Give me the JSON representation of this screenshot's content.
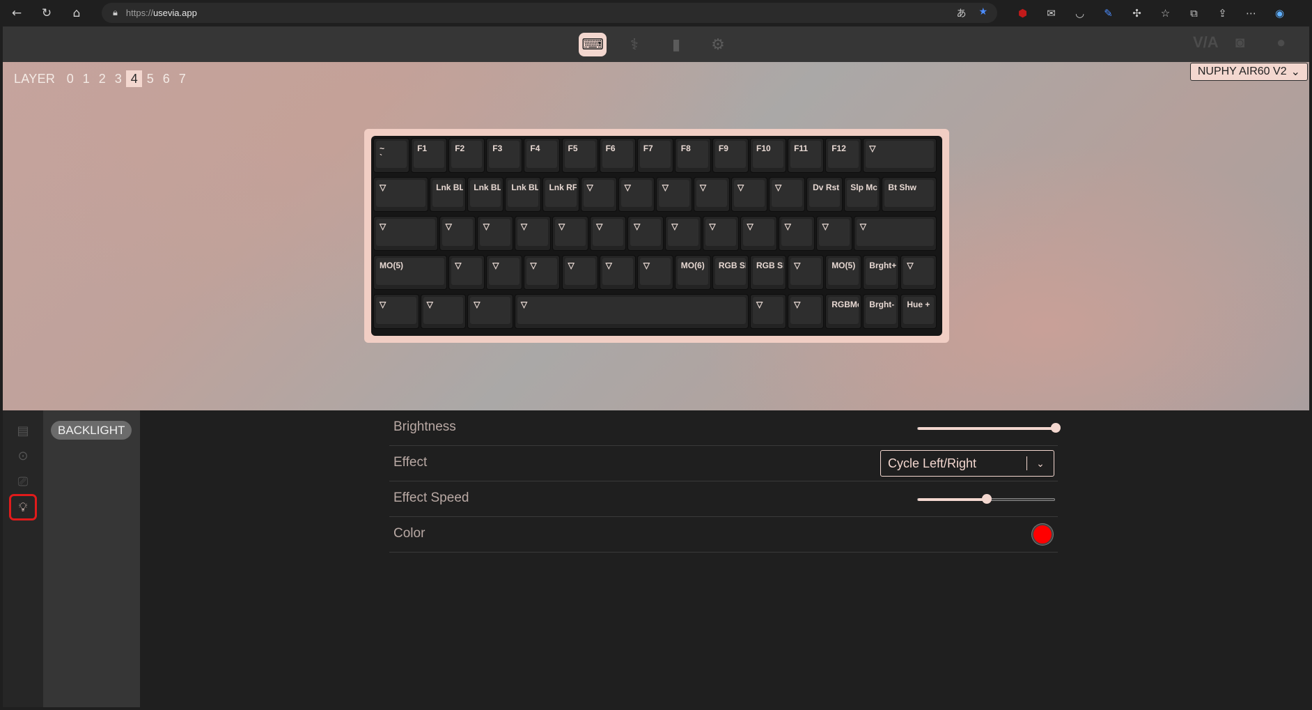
{
  "browser": {
    "url_scheme": "https://",
    "url_host": "usevia.app"
  },
  "layers": {
    "label": "LAYER",
    "items": [
      "0",
      "1",
      "2",
      "3",
      "4",
      "5",
      "6",
      "7"
    ],
    "active": "4"
  },
  "device": {
    "name": "NUPHY AIR60 V2"
  },
  "keyboard": {
    "rows": [
      [
        [
          "~\n`",
          1
        ],
        [
          "F1",
          1
        ],
        [
          "F2",
          1
        ],
        [
          "F3",
          1
        ],
        [
          "F4",
          1
        ],
        [
          "F5",
          1
        ],
        [
          "F6",
          1
        ],
        [
          "F7",
          1
        ],
        [
          "F8",
          1
        ],
        [
          "F9",
          1
        ],
        [
          "F10",
          1
        ],
        [
          "F11",
          1
        ],
        [
          "F12",
          1
        ],
        [
          "▽",
          2
        ]
      ],
      [
        [
          "▽",
          1.5
        ],
        [
          "Lnk BL",
          1
        ],
        [
          "Lnk BL",
          1
        ],
        [
          "Lnk BL",
          1
        ],
        [
          "Lnk RF",
          1
        ],
        [
          "▽",
          1
        ],
        [
          "▽",
          1
        ],
        [
          "▽",
          1
        ],
        [
          "▽",
          1
        ],
        [
          "▽",
          1
        ],
        [
          "▽",
          1
        ],
        [
          "Dv Rst",
          1
        ],
        [
          "Slp Mc",
          1
        ],
        [
          "Bt Shw",
          1.5
        ]
      ],
      [
        [
          "▽",
          1.75
        ],
        [
          "▽",
          1
        ],
        [
          "▽",
          1
        ],
        [
          "▽",
          1
        ],
        [
          "▽",
          1
        ],
        [
          "▽",
          1
        ],
        [
          "▽",
          1
        ],
        [
          "▽",
          1
        ],
        [
          "▽",
          1
        ],
        [
          "▽",
          1
        ],
        [
          "▽",
          1
        ],
        [
          "▽",
          1
        ],
        [
          "▽",
          2.25
        ]
      ],
      [
        [
          "MO(5)",
          2
        ],
        [
          "▽",
          1
        ],
        [
          "▽",
          1
        ],
        [
          "▽",
          1
        ],
        [
          "▽",
          1
        ],
        [
          "▽",
          1
        ],
        [
          "▽",
          1
        ],
        [
          "MO(6)",
          1
        ],
        [
          "RGB SI",
          1
        ],
        [
          "RGB SI",
          1
        ],
        [
          "▽",
          1
        ],
        [
          "MO(5)",
          1
        ],
        [
          "Brght+",
          1
        ],
        [
          "▽",
          1
        ]
      ],
      [
        [
          "▽",
          1.25
        ],
        [
          "▽",
          1.25
        ],
        [
          "▽",
          1.25
        ],
        [
          "▽",
          6.25
        ],
        [
          "▽",
          1
        ],
        [
          "▽",
          1
        ],
        [
          "RGBMo",
          1
        ],
        [
          "Brght-",
          1
        ],
        [
          "Hue +",
          1
        ]
      ]
    ]
  },
  "panel": {
    "section": "BACKLIGHT",
    "settings": {
      "brightness": {
        "label": "Brightness",
        "value": 1.0
      },
      "effect": {
        "label": "Effect",
        "value": "Cycle Left/Right"
      },
      "effect_speed": {
        "label": "Effect Speed",
        "value": 0.5
      },
      "color": {
        "label": "Color",
        "value": "#ff0000"
      }
    }
  },
  "colors": {
    "accent": "#f3d7cf",
    "highlight": "#e01b1b"
  }
}
